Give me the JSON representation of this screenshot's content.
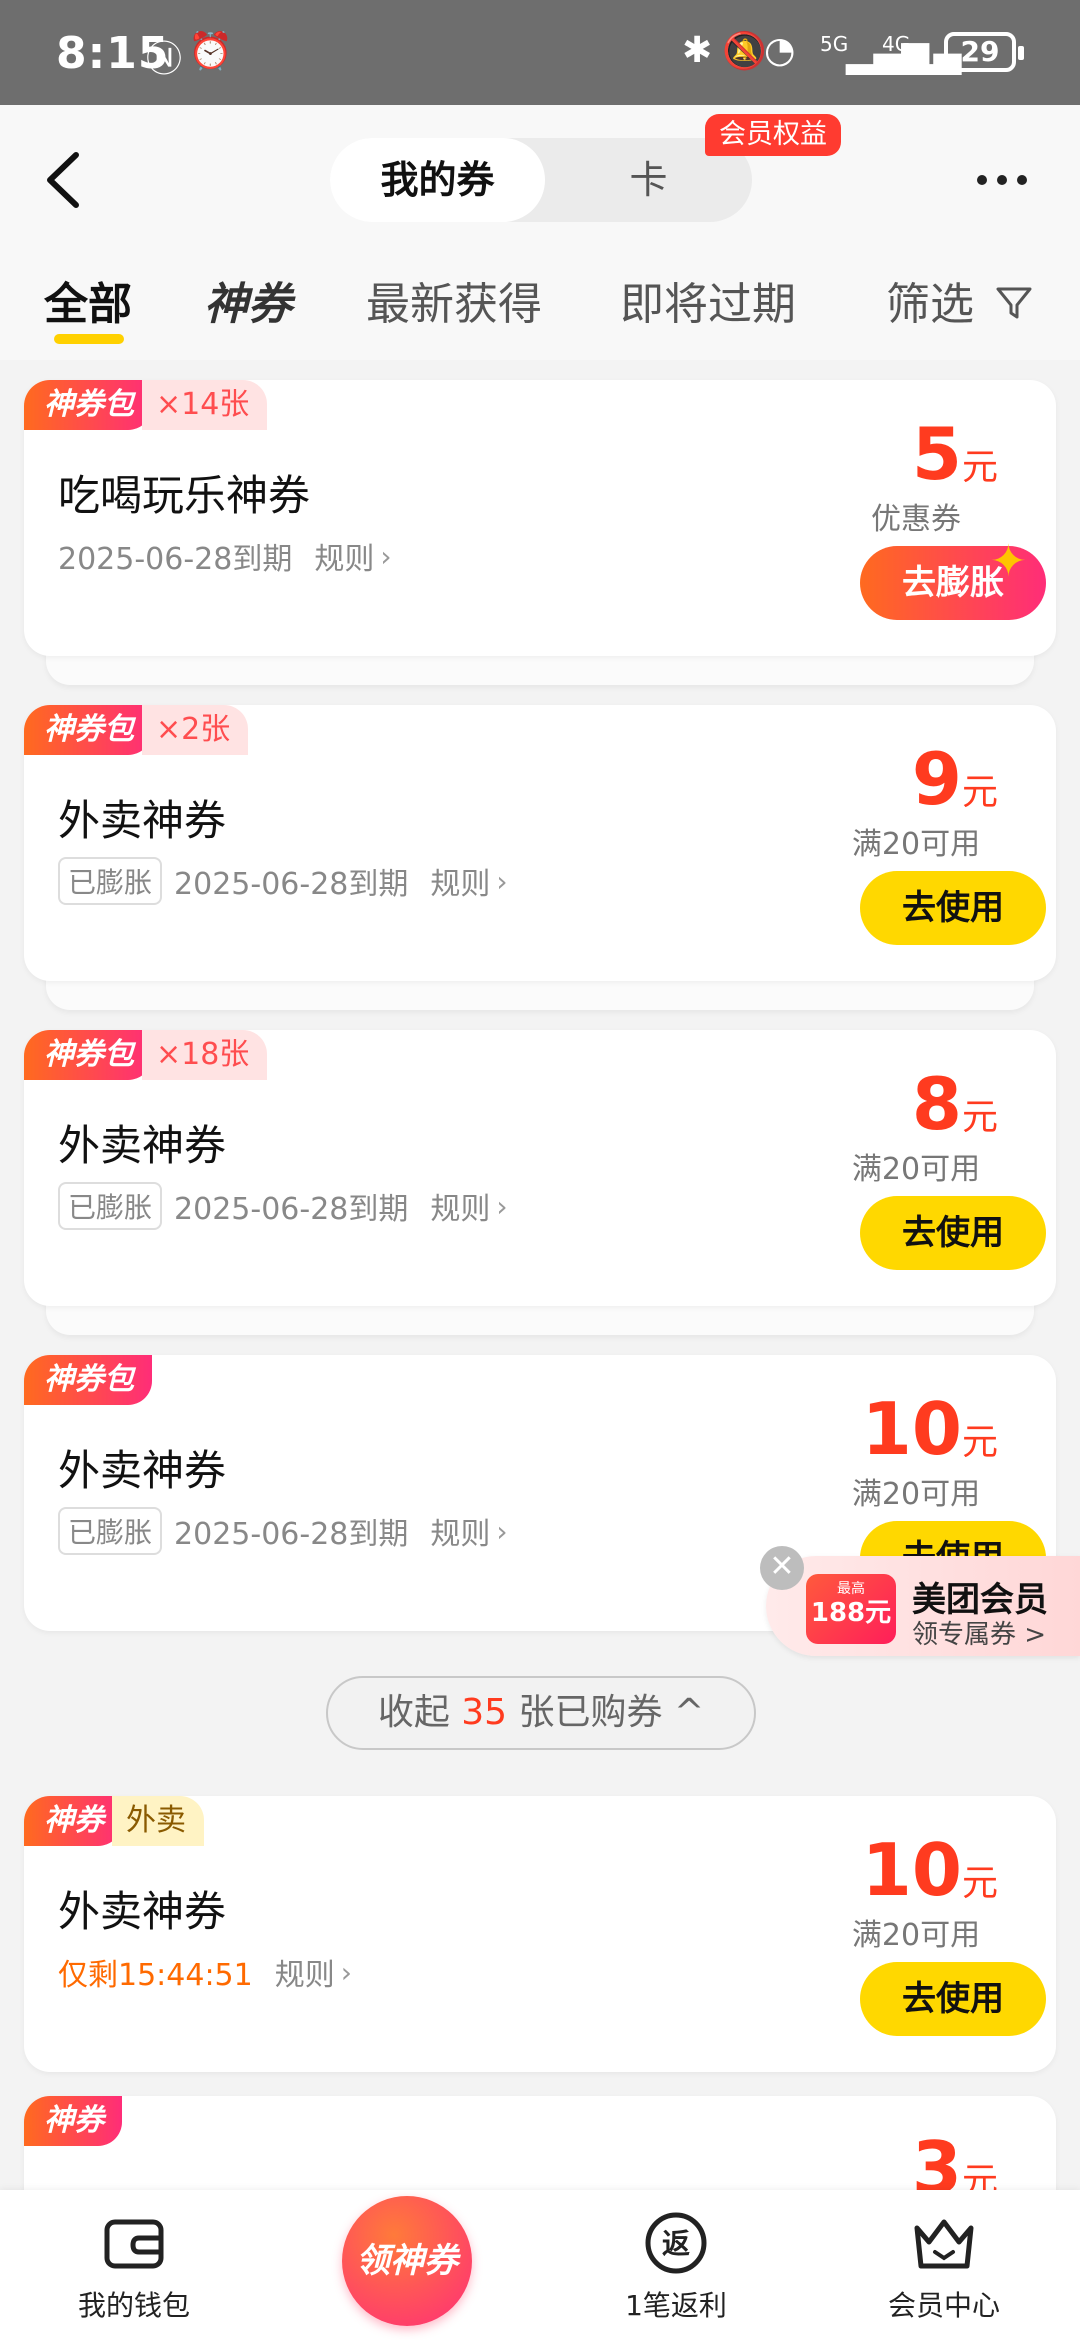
{
  "status_bar": {
    "time": "8:15",
    "battery": "29",
    "signal_5g": "5G",
    "signal_4g": "4G"
  },
  "header": {
    "tab_active": "我的券",
    "tab_other": "卡",
    "badge": "会员权益"
  },
  "filter_tabs": [
    {
      "label": "全部"
    },
    {
      "label": "神券"
    },
    {
      "label": "最新获得"
    },
    {
      "label": "即将过期"
    },
    {
      "label": "筛选"
    }
  ],
  "cards": [
    {
      "tag": "神券包",
      "count": "×14张",
      "title": "吃喝玩乐神券",
      "expire": "2025-06-28到期",
      "rule": "规则",
      "amount": "5",
      "unit": "元",
      "note": "优惠券",
      "button": "去膨胀"
    },
    {
      "tag": "神券包",
      "count": "×2张",
      "title": "外卖神券",
      "chip": "已膨胀",
      "expire": "2025-06-28到期",
      "rule": "规则",
      "amount": "9",
      "unit": "元",
      "note": "满20可用",
      "button": "去使用"
    },
    {
      "tag": "神券包",
      "count": "×18张",
      "title": "外卖神券",
      "chip": "已膨胀",
      "expire": "2025-06-28到期",
      "rule": "规则",
      "amount": "8",
      "unit": "元",
      "note": "满20可用",
      "button": "去使用"
    },
    {
      "tag": "神券包",
      "title": "外卖神券",
      "chip": "已膨胀",
      "expire": "2025-06-28到期",
      "rule": "规则",
      "amount": "10",
      "unit": "元",
      "note": "满20可用",
      "button": "去使用"
    },
    {
      "tag": "神券",
      "category": "外卖",
      "title": "外卖神券",
      "countdown": "仅剩15:44:51",
      "rule": "规则",
      "amount": "10",
      "unit": "元",
      "note": "满20可用",
      "button": "去使用"
    },
    {
      "tag": "神券",
      "amount": "3",
      "unit": "元"
    }
  ],
  "collapse": {
    "prefix": "收起",
    "count": "35",
    "suffix": "张已购券",
    "arrow": "^"
  },
  "floating_promo": {
    "img_top": "最高",
    "img_amount": "188元",
    "title": "美团会员",
    "subtitle": "领专属券",
    "chevron": ">"
  },
  "bottom_nav": [
    {
      "label": "我的钱包",
      "icon": "wallet-icon"
    },
    {
      "label": "领神券",
      "icon": "get-coupon-icon"
    },
    {
      "label": "1笔返利",
      "icon": "rebate-icon",
      "glyph": "返"
    },
    {
      "label": "会员中心",
      "icon": "crown-icon"
    }
  ],
  "colors": {
    "accent_yellow": "#ffd800",
    "price_red": "#ff3b1f",
    "tag_gradient_start": "#ff6a1f",
    "tag_gradient_end": "#ff2d78"
  }
}
